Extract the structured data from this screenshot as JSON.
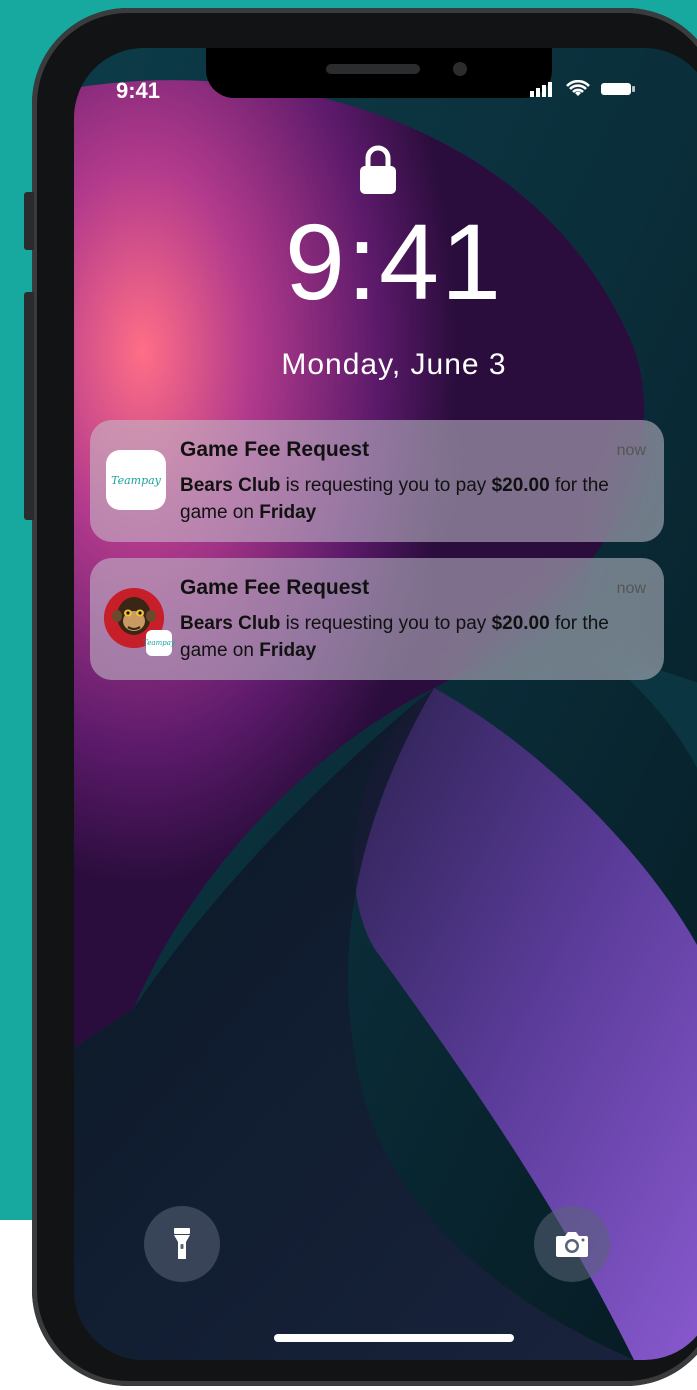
{
  "status_bar": {
    "time": "9:41"
  },
  "lock_screen": {
    "time": "9:41",
    "date": "Monday, June 3"
  },
  "notifications": [
    {
      "title": "Game Fee Request",
      "time": "now",
      "sender": "Bears Club",
      "text_1": " is requesting you to pay ",
      "amount": "$20.00",
      "text_2": " for the game on ",
      "day": "Friday",
      "icon": "teampay-app-icon",
      "icon_text": "Teampay"
    },
    {
      "title": "Game Fee Request",
      "time": "now",
      "sender": "Bears Club",
      "text_1": " is requesting you to pay ",
      "amount": "$20.00",
      "text_2": " for the game on ",
      "day": "Friday",
      "icon": "monkey-avatar-icon",
      "icon_text": "Teampay"
    }
  ],
  "controls": {
    "flashlight_icon": "flashlight-icon",
    "camera_icon": "camera-icon"
  },
  "colors": {
    "background_teal": "#17a89f",
    "phone_frame": "#121314",
    "notification_bg": "#c3c3cd"
  }
}
